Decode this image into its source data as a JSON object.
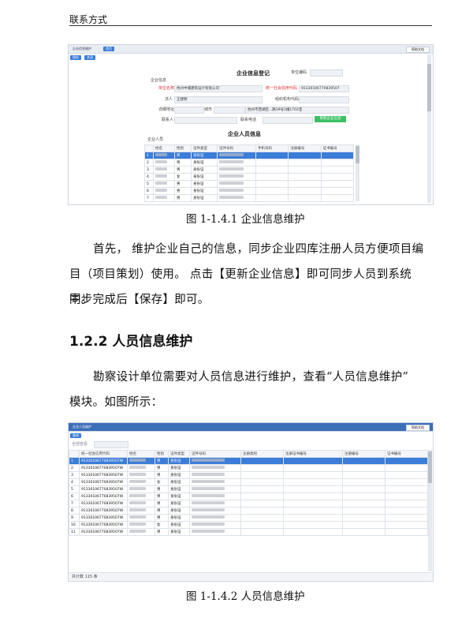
{
  "page": {
    "header": "联系方式",
    "caption1": "图 1-1.4.1 企业信息维护",
    "para1_line1": "首先， 维护企业自己的信息，同步企业四库注册人员方便项目编",
    "para1_line2": "目（项目策划）使用。 点击【更新企业信息】即可同步人员到系统中。",
    "para1_line3": "同步完成后【保存】即可。",
    "section_heading": "1.2.2 人员信息维护",
    "para2_line1": "勘察设计单位需要对人员信息进行维护，查看“人员信息维护”",
    "para2_line2": "模块。如图所示：",
    "caption2": "图 1-1.4.2 人员信息维护"
  },
  "shot1": {
    "tab1": "企业信息维护",
    "tab2": "首页",
    "top_right": "帮助文档",
    "btn_save": "保存",
    "btn_close": "关闭",
    "title": "企业信息登记",
    "unit_code_label": "单位编码",
    "group_label": "企业信息",
    "name_label": "单位名称",
    "name_value": "杭州中瀚建筑设计有限公司",
    "credit_label": "统一社会信用代码",
    "credit_value": "91330106770839507",
    "legal_label": "法人",
    "legal_value": "王建明",
    "org_label": "组织机构代码",
    "addr_label": "详细地址",
    "city_label": "城市",
    "addr_value": "杭州市西湖区...路39号1幢1702室",
    "contact_label": "联系人",
    "phone_label": "联系电话",
    "update_btn": "更新企业信息",
    "staff_title": "企业人员信息",
    "staff_group": "企业人员",
    "columns": [
      "",
      "姓名",
      "性别",
      "证件类型",
      "证件号码",
      "手机号码",
      "注册编号",
      "证书编号"
    ],
    "rows": [
      {
        "n": "1",
        "sex": "男",
        "type": "身份证"
      },
      {
        "n": "2",
        "sex": "男",
        "type": "身份证"
      },
      {
        "n": "3",
        "sex": "男",
        "type": "身份证"
      },
      {
        "n": "4",
        "sex": "女",
        "type": "身份证"
      },
      {
        "n": "5",
        "sex": "男",
        "type": "身份证"
      },
      {
        "n": "6",
        "sex": "男",
        "type": "身份证"
      },
      {
        "n": "7",
        "sex": "男",
        "type": "身份证"
      }
    ]
  },
  "shot2": {
    "tab1": "企业人员维护",
    "top_right": "帮助文档",
    "btn_query": "查询",
    "filter_label": "全部查看",
    "columns": [
      "",
      "统一社会信用代码",
      "姓名",
      "性别",
      "证件类型",
      "证件号码",
      "注册类别",
      "注册证书编号",
      "注册编号",
      "证书编号"
    ],
    "rows": [
      {
        "n": "1",
        "code": "91330106770839507W",
        "sex": "男",
        "type": "身份证"
      },
      {
        "n": "2",
        "code": "91330106770839507W",
        "sex": "男",
        "type": "身份证"
      },
      {
        "n": "3",
        "code": "91330106770839507W",
        "sex": "男",
        "type": "身份证"
      },
      {
        "n": "4",
        "code": "91330106770839507W",
        "sex": "女",
        "type": "身份证"
      },
      {
        "n": "5",
        "code": "91330106770839507W",
        "sex": "男",
        "type": "身份证"
      },
      {
        "n": "6",
        "code": "91330106770839507W",
        "sex": "男",
        "type": "身份证"
      },
      {
        "n": "7",
        "code": "91330106770839507W",
        "sex": "男",
        "type": "身份证"
      },
      {
        "n": "8",
        "code": "91330106770839507W",
        "sex": "男",
        "type": "身份证"
      },
      {
        "n": "9",
        "code": "91330106770839507W",
        "sex": "男",
        "type": "身份证"
      },
      {
        "n": "10",
        "code": "91330106770839507W",
        "sex": "女",
        "type": "身份证"
      },
      {
        "n": "11",
        "code": "91330106770839507W",
        "sex": "男",
        "type": "身份证"
      }
    ],
    "footer": "共计数  115 条"
  }
}
